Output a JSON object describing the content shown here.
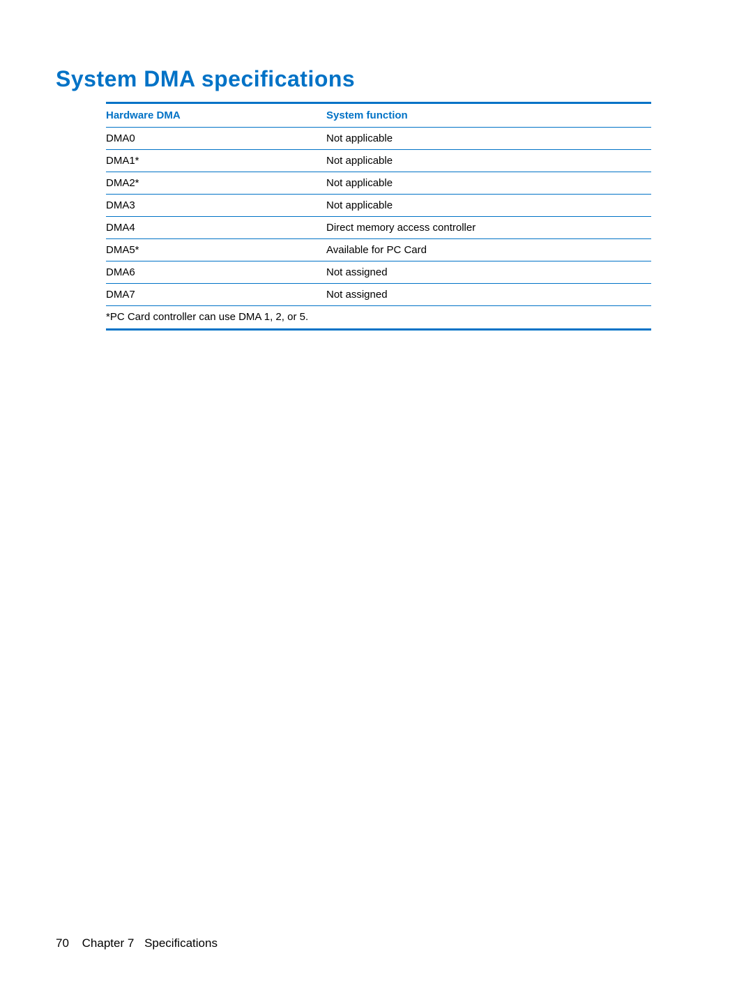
{
  "heading": "System DMA specifications",
  "table": {
    "headers": {
      "col1": "Hardware DMA",
      "col2": "System function"
    },
    "rows": [
      {
        "col1": "DMA0",
        "col2": "Not applicable"
      },
      {
        "col1": "DMA1*",
        "col2": "Not applicable"
      },
      {
        "col1": "DMA2*",
        "col2": "Not applicable"
      },
      {
        "col1": "DMA3",
        "col2": "Not applicable"
      },
      {
        "col1": "DMA4",
        "col2": "Direct memory access controller"
      },
      {
        "col1": "DMA5*",
        "col2": "Available for PC Card"
      },
      {
        "col1": "DMA6",
        "col2": "Not assigned"
      },
      {
        "col1": "DMA7",
        "col2": "Not assigned"
      }
    ],
    "footnote": "*PC Card controller can use DMA 1, 2, or 5."
  },
  "footer": {
    "page": "70",
    "chapter": "Chapter 7",
    "title": "Specifications"
  }
}
